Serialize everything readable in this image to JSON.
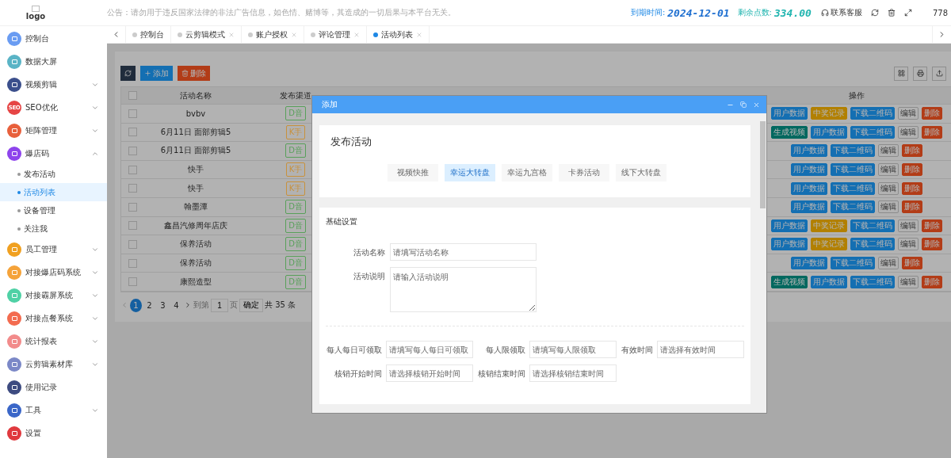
{
  "header": {
    "logo_alt": "logo",
    "notice": "公告：请勿用于违反国家法律的非法广告信息，如色情、赌博等，其造成的一切后果与本平台无关。",
    "expiry_label": "到期时间:",
    "expiry_value": "2024-12-01",
    "points_label": "剩余点数:",
    "points_value": "334.00",
    "support": "联系客服",
    "user": "778"
  },
  "sidebar": {
    "items": [
      {
        "label": "控制台",
        "kind": "link",
        "color": "#6a9cf2"
      },
      {
        "label": "数据大屏",
        "kind": "link",
        "color": "#5ab4c6"
      },
      {
        "label": "视频剪辑",
        "kind": "group",
        "expanded": false,
        "color": "#3b4f8c"
      },
      {
        "label": "SEO优化",
        "kind": "group",
        "expanded": false,
        "color": "#e64545",
        "icon_text": "SEO"
      },
      {
        "label": "矩阵管理",
        "kind": "group",
        "expanded": false,
        "color": "#e8603c"
      },
      {
        "label": "爆店码",
        "kind": "group",
        "expanded": true,
        "color": "#8e44ec",
        "children": [
          {
            "label": "发布活动",
            "selected": false
          },
          {
            "label": "活动列表",
            "selected": true
          },
          {
            "label": "设备管理",
            "selected": false
          },
          {
            "label": "关注我",
            "selected": false
          }
        ]
      },
      {
        "label": "员工管理",
        "kind": "group",
        "expanded": false,
        "color": "#f0a020"
      },
      {
        "label": "对接爆店码系统",
        "kind": "group",
        "expanded": false,
        "color": "#f5a33a"
      },
      {
        "label": "对接霸屏系统",
        "kind": "group",
        "expanded": false,
        "color": "#4fd1a5"
      },
      {
        "label": "对接点餐系统",
        "kind": "group",
        "expanded": false,
        "color": "#f36b4f"
      },
      {
        "label": "统计报表",
        "kind": "group",
        "expanded": false,
        "color": "#f28b8b"
      },
      {
        "label": "云剪辑素材库",
        "kind": "group",
        "expanded": false,
        "color": "#7b88c7"
      },
      {
        "label": "使用记录",
        "kind": "link",
        "color": "#3d4b80"
      },
      {
        "label": "工具",
        "kind": "group",
        "expanded": false,
        "color": "#3a66c8"
      },
      {
        "label": "设置",
        "kind": "link",
        "color": "#e0393e"
      }
    ]
  },
  "tabs": [
    {
      "label": "控制台",
      "selected": false,
      "closable": false
    },
    {
      "label": "云剪辑模式",
      "selected": false,
      "closable": true
    },
    {
      "label": "账户授权",
      "selected": false,
      "closable": true
    },
    {
      "label": "评论管理",
      "selected": false,
      "closable": true
    },
    {
      "label": "活动列表",
      "selected": true,
      "closable": true
    }
  ],
  "toolbar": {
    "add": "添加",
    "delete": "删除"
  },
  "table": {
    "select_all": {
      "checked": false
    },
    "columns": [
      {
        "label": "活动名称"
      },
      {
        "label": "发布渠道"
      },
      {
        "label": "操作"
      }
    ],
    "rows": [
      {
        "checked": false,
        "name": "bvbv",
        "channel": {
          "label": "D音",
          "color": "#58a05a"
        },
        "actions": [
          {
            "label": "用户数据",
            "kind": "primary"
          },
          {
            "label": "中奖记录",
            "kind": "warm"
          },
          {
            "label": "下载二维码",
            "kind": "primary"
          },
          {
            "label": "编辑",
            "kind": "default"
          },
          {
            "label": "删除",
            "kind": "danger"
          }
        ]
      },
      {
        "checked": false,
        "name": "6月11日 面部剪辑5",
        "channel": {
          "label": "K手",
          "color": "#c8913c"
        },
        "actions": [
          {
            "label": "生成视频",
            "kind": "success"
          },
          {
            "label": "用户数据",
            "kind": "primary"
          },
          {
            "label": "下载二维码",
            "kind": "primary"
          },
          {
            "label": "编辑",
            "kind": "default"
          },
          {
            "label": "删除",
            "kind": "danger"
          }
        ]
      },
      {
        "checked": false,
        "name": "6月11日 面部剪辑5",
        "channel": {
          "label": "D音",
          "color": "#58a05a"
        },
        "actions": [
          {
            "label": "用户数据",
            "kind": "primary"
          },
          {
            "label": "下载二维码",
            "kind": "primary"
          },
          {
            "label": "编辑",
            "kind": "default"
          },
          {
            "label": "删除",
            "kind": "danger"
          }
        ]
      },
      {
        "checked": false,
        "name": "快手",
        "channel": {
          "label": "K手",
          "color": "#c8913c"
        },
        "actions": [
          {
            "label": "用户数据",
            "kind": "primary"
          },
          {
            "label": "下载二维码",
            "kind": "primary"
          },
          {
            "label": "编辑",
            "kind": "default"
          },
          {
            "label": "删除",
            "kind": "danger"
          }
        ]
      },
      {
        "checked": false,
        "name": "快手",
        "channel": {
          "label": "K手",
          "color": "#c8913c"
        },
        "actions": [
          {
            "label": "用户数据",
            "kind": "primary"
          },
          {
            "label": "下载二维码",
            "kind": "primary"
          },
          {
            "label": "编辑",
            "kind": "default"
          },
          {
            "label": "删除",
            "kind": "danger"
          }
        ]
      },
      {
        "checked": false,
        "name": "翰墨潭",
        "channel": {
          "label": "D音",
          "color": "#58a05a"
        },
        "actions": [
          {
            "label": "用户数据",
            "kind": "primary"
          },
          {
            "label": "下载二维码",
            "kind": "primary"
          },
          {
            "label": "编辑",
            "kind": "default"
          },
          {
            "label": "删除",
            "kind": "danger"
          }
        ]
      },
      {
        "checked": false,
        "name": "鑫昌汽修周年店庆",
        "channel": {
          "label": "D音",
          "color": "#58a05a"
        },
        "actions": [
          {
            "label": "用户数据",
            "kind": "primary"
          },
          {
            "label": "中奖记录",
            "kind": "warm"
          },
          {
            "label": "下载二维码",
            "kind": "primary"
          },
          {
            "label": "编辑",
            "kind": "default"
          },
          {
            "label": "删除",
            "kind": "danger"
          }
        ]
      },
      {
        "checked": false,
        "name": "保养活动",
        "channel": {
          "label": "D音",
          "color": "#58a05a"
        },
        "actions": [
          {
            "label": "用户数据",
            "kind": "primary"
          },
          {
            "label": "中奖记录",
            "kind": "warm"
          },
          {
            "label": "下载二维码",
            "kind": "primary"
          },
          {
            "label": "编辑",
            "kind": "default"
          },
          {
            "label": "删除",
            "kind": "danger"
          }
        ]
      },
      {
        "checked": false,
        "name": "保养活动",
        "channel": {
          "label": "D音",
          "color": "#58a05a"
        },
        "actions": [
          {
            "label": "用户数据",
            "kind": "primary"
          },
          {
            "label": "下载二维码",
            "kind": "primary"
          },
          {
            "label": "编辑",
            "kind": "default"
          },
          {
            "label": "删除",
            "kind": "danger"
          }
        ]
      },
      {
        "checked": false,
        "name": "康熙造型",
        "channel": {
          "label": "D音",
          "color": "#58a05a"
        },
        "actions": [
          {
            "label": "生成视频",
            "kind": "success"
          },
          {
            "label": "用户数据",
            "kind": "primary"
          },
          {
            "label": "下载二维码",
            "kind": "primary"
          },
          {
            "label": "编辑",
            "kind": "default"
          },
          {
            "label": "删除",
            "kind": "danger"
          }
        ]
      }
    ]
  },
  "pagination": {
    "pages": [
      {
        "label": "1",
        "selected": true
      },
      {
        "label": "2",
        "selected": false
      },
      {
        "label": "3",
        "selected": false
      },
      {
        "label": "4",
        "selected": false
      }
    ],
    "goto_label": "到第",
    "goto_value": "1",
    "page_unit": "页",
    "confirm": "确定",
    "total": "共 35 条"
  },
  "modal": {
    "title": "添加",
    "heading": "发布活动",
    "types": [
      {
        "label": "视频快推",
        "selected": false
      },
      {
        "label": "幸运大转盘",
        "selected": true
      },
      {
        "label": "幸运九宫格",
        "selected": false
      },
      {
        "label": "卡券活动",
        "selected": false
      },
      {
        "label": "线下大转盘",
        "selected": false
      }
    ],
    "section": "基础设置",
    "name_field": {
      "label": "活动名称",
      "placeholder": "请填写活动名称"
    },
    "desc_field": {
      "label": "活动说明",
      "placeholder": "请输入活动说明"
    },
    "grid_fields": [
      {
        "label": "每人每日可领取",
        "placeholder": "请填写每人每日可领取"
      },
      {
        "label": "每人限领取",
        "placeholder": "请填写每人限领取"
      },
      {
        "label": "有效时间",
        "placeholder": "请选择有效时间"
      },
      {
        "label": "核销开始时间",
        "placeholder": "请选择核销开始时间"
      },
      {
        "label": "核销结束时间",
        "placeholder": "请选择核销结束时间"
      }
    ]
  }
}
